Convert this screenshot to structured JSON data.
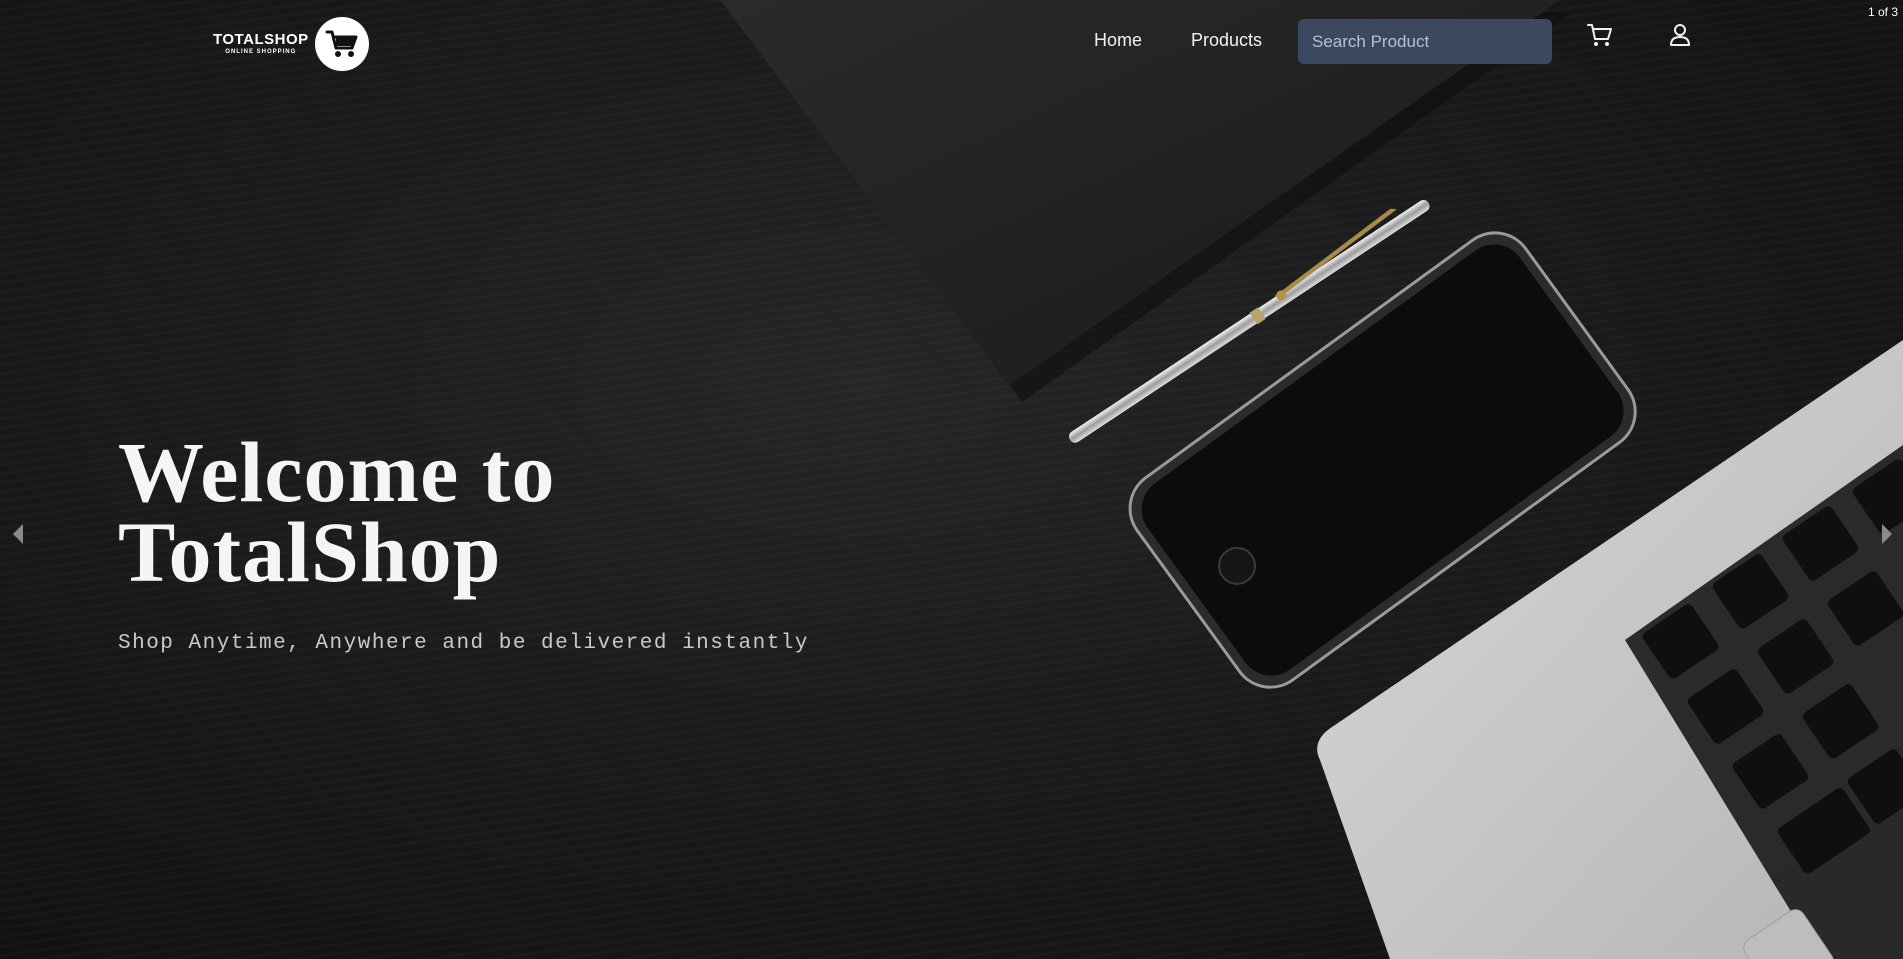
{
  "header": {
    "logo": {
      "name": "TOTALSHOP",
      "tagline": "ONLINE SHOPPING",
      "icon": "shopping-cart-icon"
    },
    "nav": {
      "home_label": "Home",
      "products_label": "Products"
    },
    "search": {
      "placeholder": "Search Product",
      "value": ""
    },
    "icons": {
      "cart": "cart-icon",
      "account": "user-icon"
    }
  },
  "slider": {
    "counter": "1 of 3",
    "current": 1,
    "total": 3,
    "prev_icon": "chevron-left-icon",
    "next_icon": "chevron-right-icon"
  },
  "hero": {
    "title_line1": "Welcome to",
    "title_line2": "TotalShop",
    "subtitle": "Shop Anytime, Anywhere and be delivered instantly"
  },
  "colors": {
    "search_bg": "#3c4860",
    "text": "#f5f5f5",
    "background": "#141414"
  }
}
